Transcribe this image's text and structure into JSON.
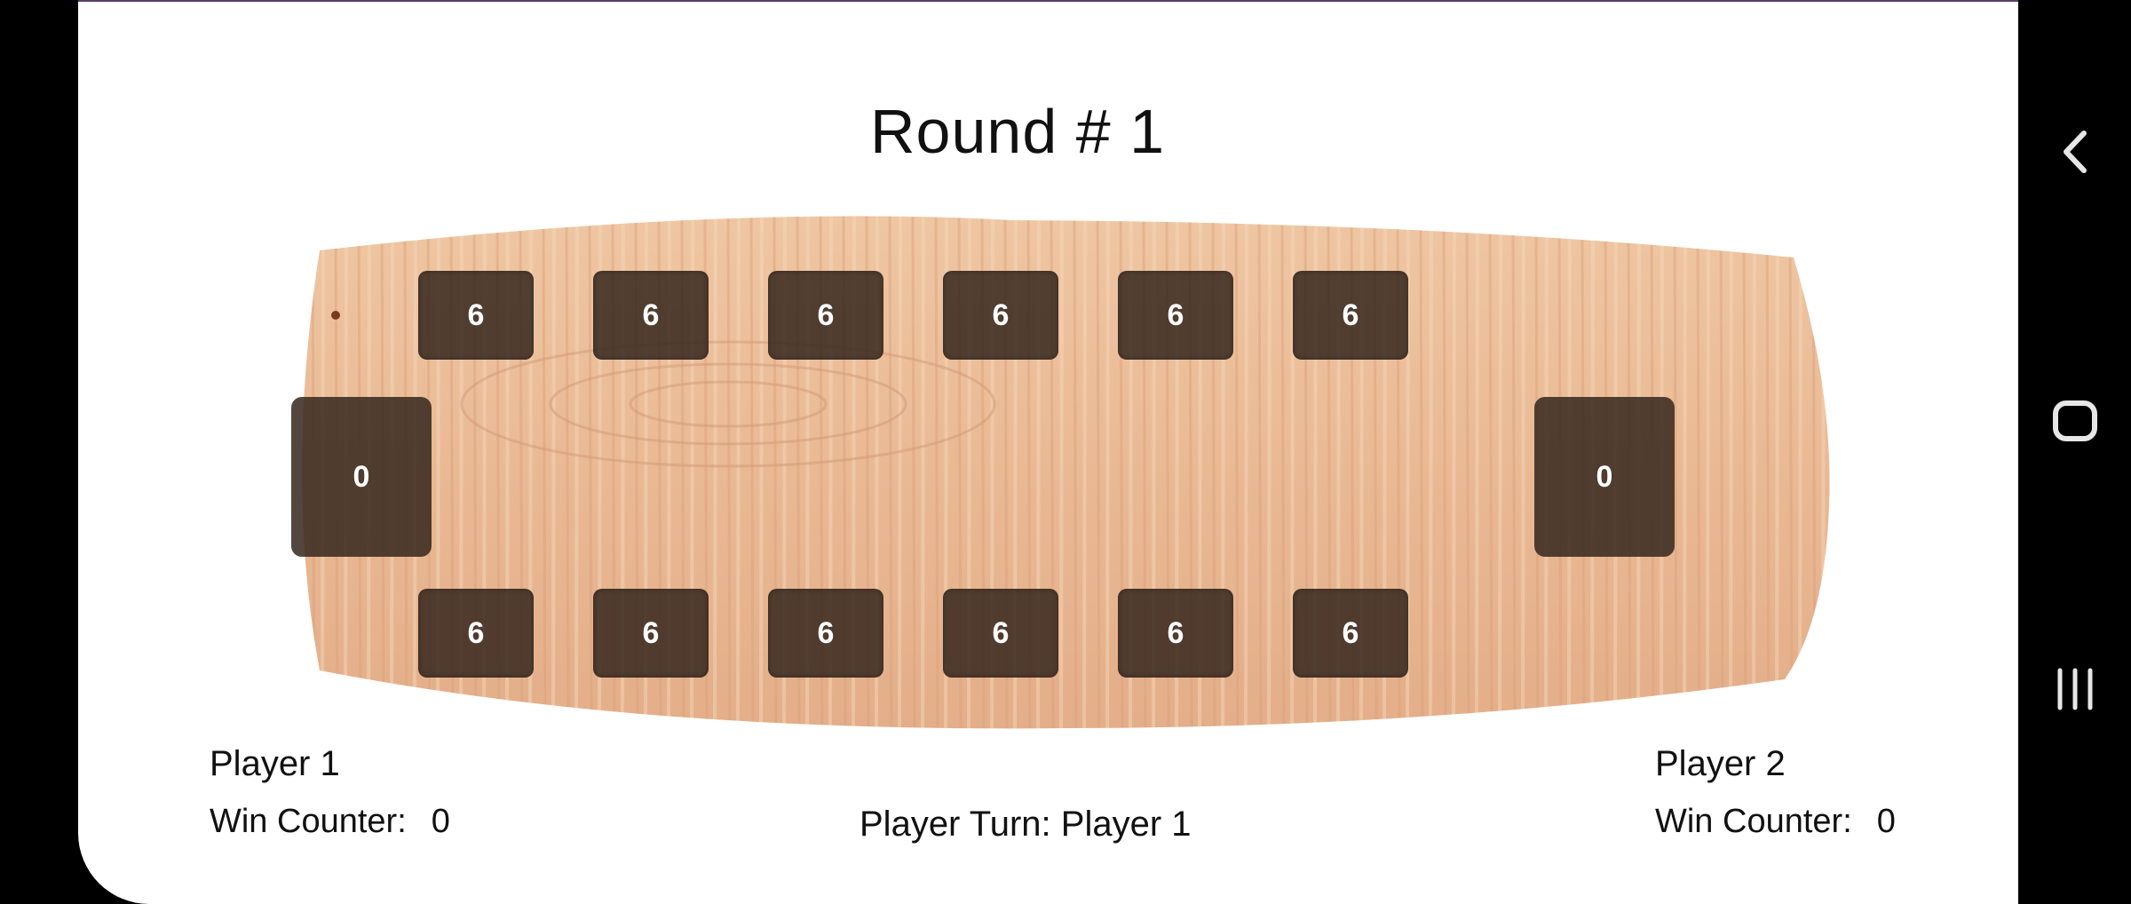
{
  "game": {
    "round_title": "Round # 1",
    "top_pits": [
      "6",
      "6",
      "6",
      "6",
      "6",
      "6"
    ],
    "bottom_pits": [
      "6",
      "6",
      "6",
      "6",
      "6",
      "6"
    ],
    "left_store": "0",
    "right_store": "0"
  },
  "player1": {
    "name": "Player 1",
    "win_label": "Win Counter:",
    "win_count": "0"
  },
  "player2": {
    "name": "Player 2",
    "win_label": "Win Counter:",
    "win_count": "0"
  },
  "status": {
    "turn_text": "Player Turn: Player 1"
  },
  "nav": {
    "back_icon": "chevron-left-icon",
    "home_icon": "home-square-icon",
    "recents_icon": "recents-bars-icon"
  },
  "colors": {
    "wood": "#e8b894",
    "pit": "#3a2a20",
    "accent": "#5a3d6e"
  }
}
